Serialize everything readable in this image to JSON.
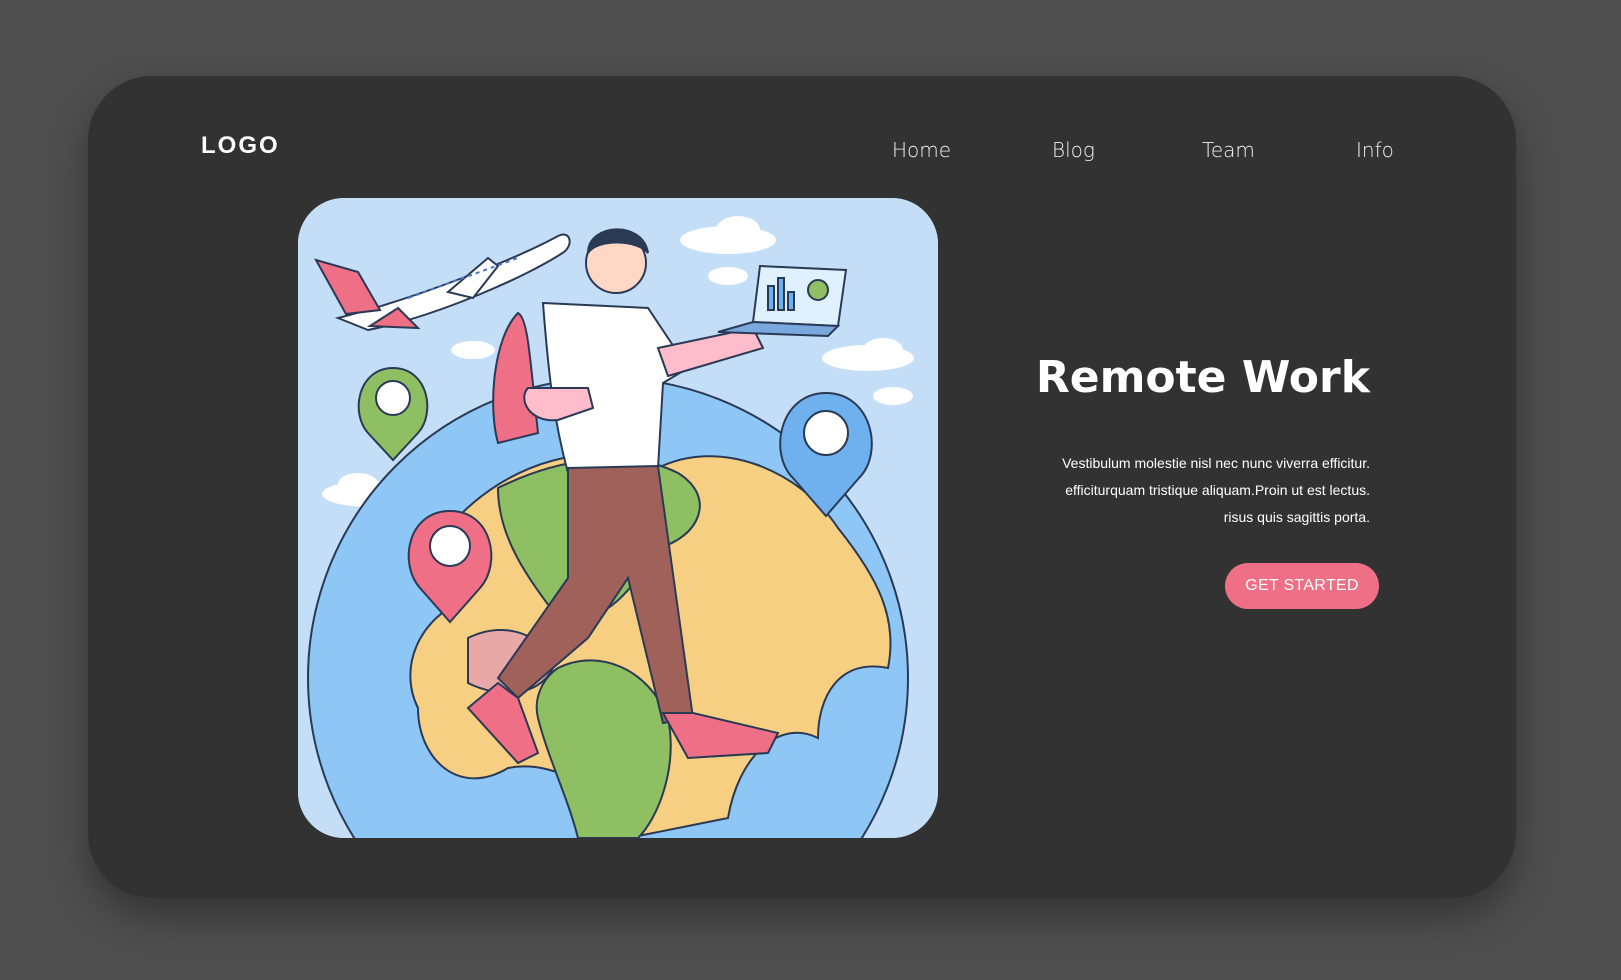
{
  "header": {
    "logo": "LOGO",
    "nav": [
      {
        "label": "Home"
      },
      {
        "label": "Blog"
      },
      {
        "label": "Team"
      },
      {
        "label": "Info"
      }
    ]
  },
  "hero": {
    "title": "Remote Work",
    "body_lines": [
      "Vestibulum molestie nisl nec nunc viverra efficitur.",
      "efficiturquam tristique aliquam.Proin ut est lectus.",
      "risus quis sagittis porta."
    ],
    "cta_label": "GET STARTED"
  },
  "colors": {
    "page_background": "#4f4f4f",
    "card_background": "#323232",
    "accent": "#ef6f86",
    "illustration_background": "#c5def7"
  },
  "illustration": {
    "icons": [
      "airplane-icon",
      "location-pin-icon",
      "globe-icon",
      "laptop-icon",
      "backpack-icon",
      "cloud-icon"
    ]
  }
}
